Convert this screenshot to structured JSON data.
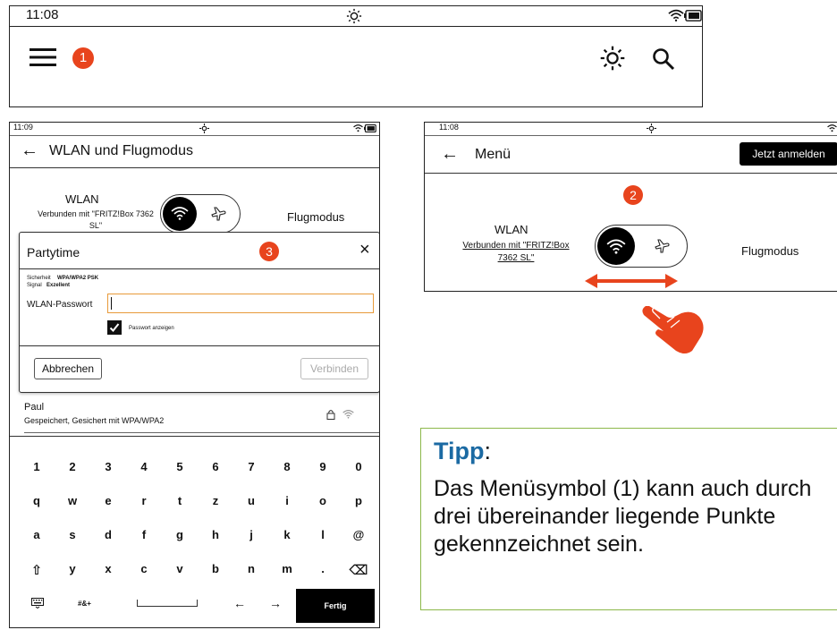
{
  "top_bar": {
    "time": "11:08",
    "badge_1": "1",
    "icons": [
      "menu-icon",
      "brightness-icon",
      "search-icon"
    ]
  },
  "wlan_screen": {
    "time": "11:09",
    "title": "WLAN und Flugmodus",
    "wlan_label": "WLAN",
    "wlan_status": "Verbunden mit \"FRITZ!Box 7362 SL\"",
    "flight_label": "Flugmodus",
    "dialog": {
      "title": "Partytime",
      "badge": "3",
      "close": "×",
      "security_label": "Sicherheit",
      "security_value": "WPA/WPA2 PSK",
      "signal_label": "Signal",
      "signal_value": "Exzellent",
      "password_label": "WLAN-Passwort",
      "password_value": "",
      "show_password_label": "Passwort anzeigen",
      "show_password_checked": true,
      "cancel_label": "Abbrechen",
      "connect_label": "Verbinden"
    },
    "network_item": {
      "name": "Paul",
      "detail": "Gespeichert, Gesichert mit WPA/WPA2"
    },
    "keyboard": {
      "row1": [
        "1",
        "2",
        "3",
        "4",
        "5",
        "6",
        "7",
        "8",
        "9",
        "0"
      ],
      "row2": [
        "q",
        "w",
        "e",
        "r",
        "t",
        "z",
        "u",
        "i",
        "o",
        "p"
      ],
      "row3": [
        "a",
        "s",
        "d",
        "f",
        "g",
        "h",
        "j",
        "k",
        "l",
        "@"
      ],
      "row4": [
        "⇧",
        "y",
        "x",
        "c",
        "v",
        "b",
        "n",
        "m",
        ".",
        "⌫"
      ],
      "symbols_label": "#&+",
      "left_arrow": "←",
      "right_arrow": "→",
      "done_label": "Fertig"
    }
  },
  "menu_screen": {
    "time": "11:08",
    "title": "Menü",
    "login_label": "Jetzt anmelden",
    "badge": "2",
    "wlan_label": "WLAN",
    "wlan_status_line1": "Verbunden mit \"FRITZ!Box",
    "wlan_status_line2": "7362 SL\"",
    "flight_label": "Flugmodus"
  },
  "tip": {
    "heading": "Tipp",
    "colon": ":",
    "text": "Das Menüsymbol (1) kann auch durch drei übereinander liegende Punkte gekennzeichnet sein.",
    "heading_color": "#1b6aa3",
    "border_color": "#8cb84a"
  },
  "colors": {
    "accent_orange": "#e8441d",
    "orange_input_border": "#e89a3a"
  }
}
